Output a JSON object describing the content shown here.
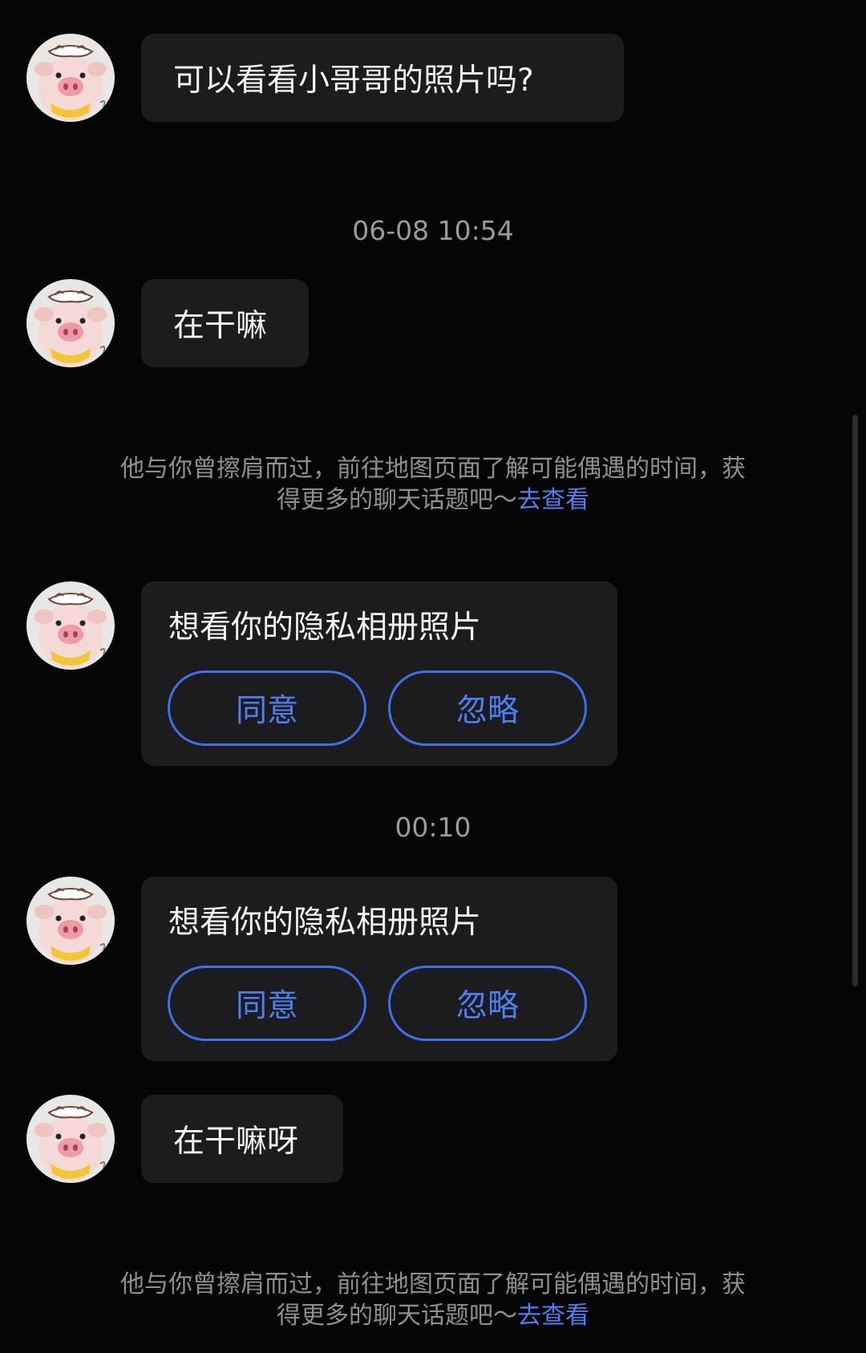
{
  "messages": {
    "m1": "可以看看小哥哥的照片吗?",
    "m2": "在干嘛",
    "m3": "在干嘛呀"
  },
  "timestamps": {
    "t1": "06-08 10:54",
    "t2": "00:10"
  },
  "system_note": {
    "text": "他与你曾擦肩而过，前往地图页面了解可能偶遇的时间，获得更多的聊天话题吧～",
    "link": "去查看"
  },
  "album_request": {
    "text": "想看你的隐私相册照片",
    "agree_label": "同意",
    "ignore_label": "忽略"
  },
  "colors": {
    "background": "#050505",
    "bubble": "#1c1c1e",
    "accent": "#4d7ff2"
  },
  "icons": {
    "avatar": "pig-avatar-icon"
  }
}
